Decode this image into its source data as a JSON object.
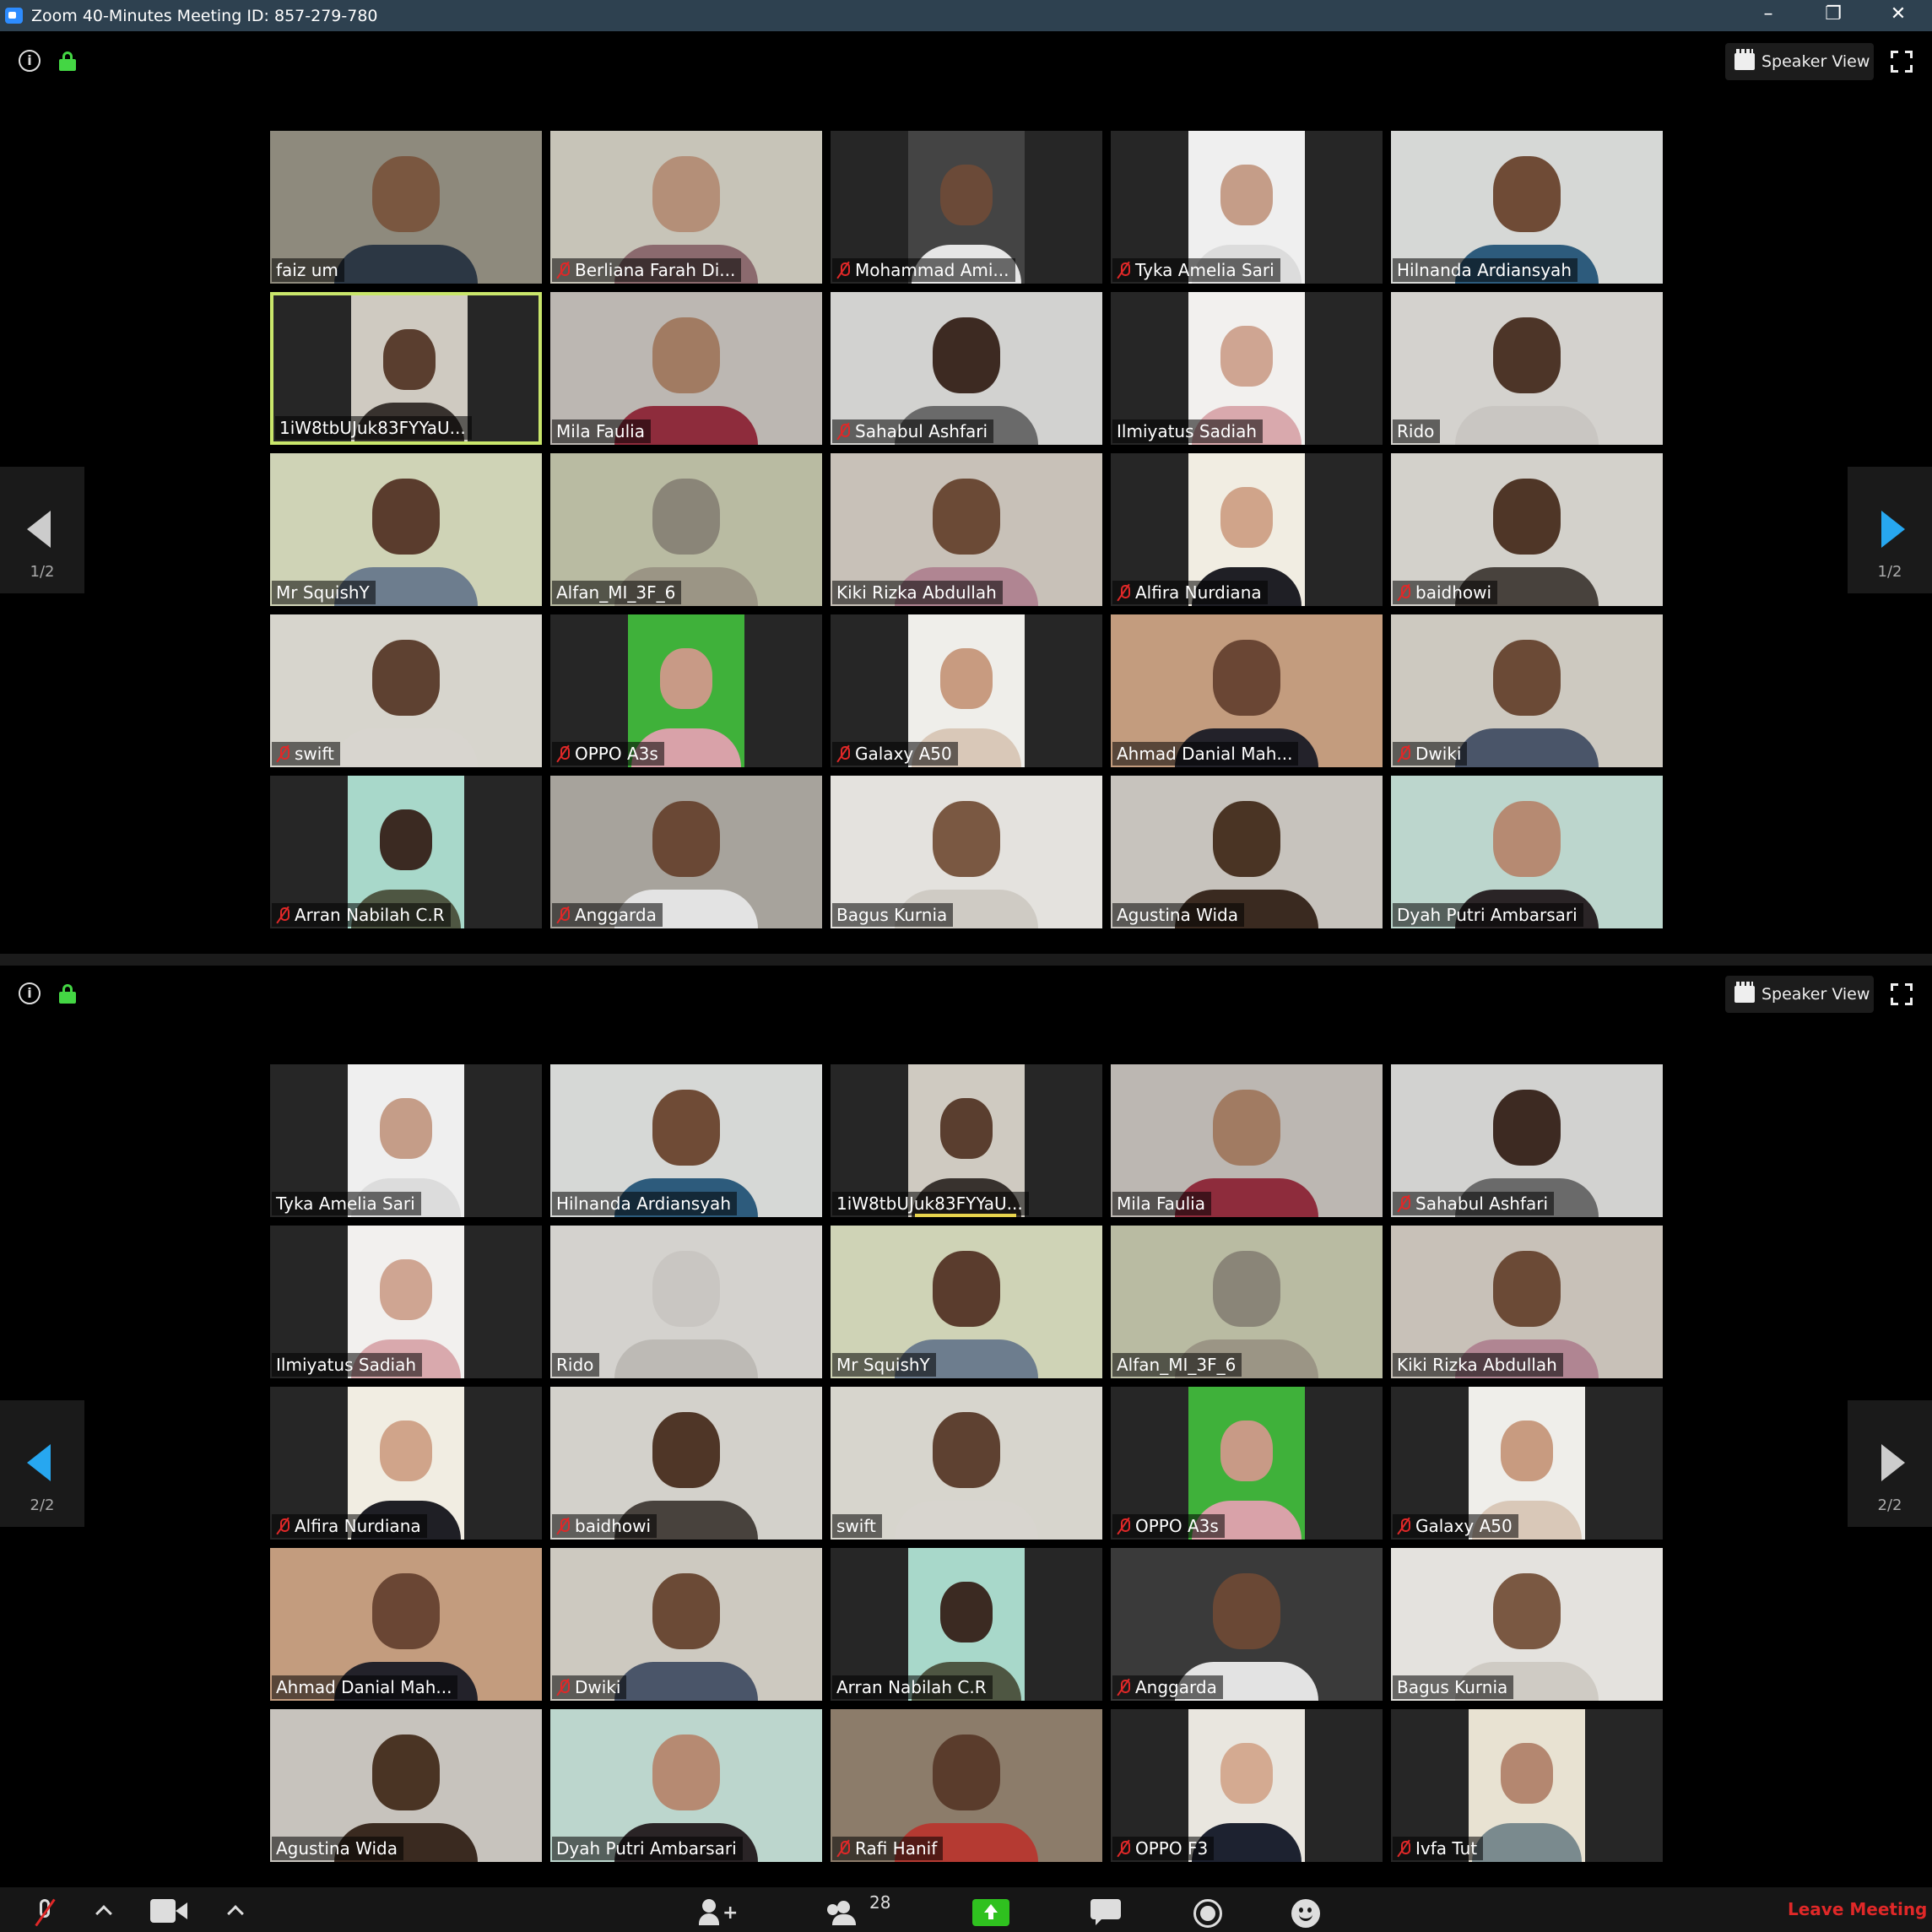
{
  "window": {
    "title": "Zoom 40-Minutes Meeting ID: 857-279-780",
    "minimize": "–",
    "restore": "❐",
    "close": "✕"
  },
  "header": {
    "speaker_view": "Speaker View"
  },
  "screens": [
    {
      "page_label": "1/2",
      "tiles": [
        {
          "name": "faiz um",
          "muted": false,
          "video": "full",
          "bg": "#8e8a7d",
          "skin": "#7a5740",
          "shirt": "#2c3744"
        },
        {
          "name": "Berliana Farah Di...",
          "muted": true,
          "video": "full",
          "bg": "#c7c4b8",
          "skin": "#b48f78",
          "shirt": "#8b6a6e"
        },
        {
          "name": "Mohammad Ami...",
          "muted": true,
          "video": "narrow",
          "bg": "#444",
          "skin": "#6b4a38",
          "shirt": "#e6e6e6"
        },
        {
          "name": "Tyka Amelia Sari",
          "muted": true,
          "video": "narrow",
          "bg": "#efefef",
          "skin": "#c59d88",
          "shirt": "#dcdcdc"
        },
        {
          "name": "Hilnanda Ardiansyah",
          "muted": false,
          "video": "full",
          "bg": "#d6d8d6",
          "skin": "#6f4b36",
          "shirt": "#2d5b7c"
        },
        {
          "name": "1iW8tbUJuk83FYYaU...",
          "muted": false,
          "video": "narrow",
          "bg": "#cfcac1",
          "skin": "#5a3e2f",
          "shirt": "#38322e",
          "active": true
        },
        {
          "name": "Mila Faulia",
          "muted": false,
          "video": "full",
          "bg": "#bcb7b2",
          "skin": "#a17b62",
          "shirt": "#8e2c3c"
        },
        {
          "name": "Sahabul Ashfari",
          "muted": true,
          "video": "full",
          "bg": "#d2d2d0",
          "skin": "#3d2a22",
          "shirt": "#6a6a6a"
        },
        {
          "name": "Ilmiyatus Sadiah",
          "muted": false,
          "video": "narrow",
          "bg": "#f2f0ee",
          "skin": "#cfa592",
          "shirt": "#d9a9ad"
        },
        {
          "name": "Rido",
          "muted": false,
          "video": "full",
          "bg": "#d4d2ce",
          "skin": "#4d3528",
          "shirt": "#c9c6c2"
        },
        {
          "name": "Mr SquishY",
          "muted": false,
          "video": "full",
          "bg": "#cfd3b6",
          "skin": "#5a3c2d",
          "shirt": "#6d7d8e"
        },
        {
          "name": "Alfan_MI_3F_6",
          "muted": false,
          "video": "full",
          "bg": "#b9bba2",
          "skin": "#8a8578",
          "shirt": "#9b9585"
        },
        {
          "name": "Kiki Rizka Abdullah",
          "muted": false,
          "video": "full",
          "bg": "#c8c1b8",
          "skin": "#6b4a36",
          "shirt": "#b08592"
        },
        {
          "name": "Alfira Nurdiana",
          "muted": true,
          "video": "narrow",
          "bg": "#f1ede2",
          "skin": "#d0a48a",
          "shirt": "#1f1f25"
        },
        {
          "name": "baidhowi",
          "muted": true,
          "video": "full",
          "bg": "#d3d1cb",
          "skin": "#4f3627",
          "shirt": "#48423d"
        },
        {
          "name": "swift",
          "muted": true,
          "video": "full",
          "bg": "#d7d5cd",
          "skin": "#5e4131",
          "shirt": "#d8d5cf"
        },
        {
          "name": "OPPO A3s",
          "muted": true,
          "video": "narrow",
          "bg": "#3fb13a",
          "skin": "#c89a86",
          "shirt": "#d9a2a9"
        },
        {
          "name": "Galaxy A50",
          "muted": true,
          "video": "narrow",
          "bg": "#efeeea",
          "skin": "#c89b80",
          "shirt": "#d9c8b8"
        },
        {
          "name": "Ahmad Danial Mah...",
          "muted": false,
          "video": "full",
          "bg": "#c39c7e",
          "skin": "#6a4634",
          "shirt": "#23222a"
        },
        {
          "name": "Dwiki",
          "muted": true,
          "video": "full",
          "bg": "#cdc9c0",
          "skin": "#6b4a36",
          "shirt": "#4a5569"
        },
        {
          "name": "Arran Nabilah C.R",
          "muted": true,
          "video": "narrow",
          "bg": "#a8d8ca",
          "skin": "#3b2a22",
          "shirt": "#4e5642"
        },
        {
          "name": "Anggarda",
          "muted": true,
          "video": "full",
          "bg": "#a7a39c",
          "skin": "#6a4835",
          "shirt": "#e3e3e3"
        },
        {
          "name": "Bagus Kurnia",
          "muted": false,
          "video": "full",
          "bg": "#e4e2de",
          "skin": "#7a5842",
          "shirt": "#cfcbc4"
        },
        {
          "name": "Agustina Wida",
          "muted": false,
          "video": "full",
          "bg": "#c7c3bd",
          "skin": "#4a3424",
          "shirt": "#3a2a20"
        },
        {
          "name": "Dyah Putri Ambarsari",
          "muted": false,
          "video": "full",
          "bg": "#bcd6cd",
          "skin": "#b68a72",
          "shirt": "#2a2426"
        }
      ]
    },
    {
      "page_label": "2/2",
      "tiles": [
        {
          "name": "Tyka Amelia Sari",
          "muted": false,
          "video": "narrow",
          "bg": "#efefef",
          "skin": "#c59d88",
          "shirt": "#dcdcdc"
        },
        {
          "name": "Hilnanda Ardiansyah",
          "muted": false,
          "video": "full",
          "bg": "#d6d8d6",
          "skin": "#6f4b36",
          "shirt": "#2d5b7c"
        },
        {
          "name": "1iW8tbUJuk83FYYaU...",
          "muted": false,
          "video": "narrow",
          "bg": "#cfcac1",
          "skin": "#5a3e2f",
          "shirt": "#38322e",
          "speaking": true
        },
        {
          "name": "Mila Faulia",
          "muted": false,
          "video": "full",
          "bg": "#bcb7b2",
          "skin": "#a17b62",
          "shirt": "#8e2c3c"
        },
        {
          "name": "Sahabul Ashfari",
          "muted": true,
          "video": "full",
          "bg": "#d2d2d0",
          "skin": "#3d2a22",
          "shirt": "#6a6a6a"
        },
        {
          "name": "Ilmiyatus Sadiah",
          "muted": false,
          "video": "narrow",
          "bg": "#f2f0ee",
          "skin": "#cfa592",
          "shirt": "#d9a9ad"
        },
        {
          "name": "Rido",
          "muted": false,
          "video": "full",
          "bg": "#d4d2ce",
          "skin": "#c9c6c2",
          "shirt": "#bdbab5"
        },
        {
          "name": "Mr SquishY",
          "muted": false,
          "video": "full",
          "bg": "#cfd3b6",
          "skin": "#5a3c2d",
          "shirt": "#6d7d8e"
        },
        {
          "name": "Alfan_MI_3F_6",
          "muted": false,
          "video": "full",
          "bg": "#b9bba2",
          "skin": "#8a8578",
          "shirt": "#9b9585"
        },
        {
          "name": "Kiki Rizka Abdullah",
          "muted": false,
          "video": "full",
          "bg": "#c8c1b8",
          "skin": "#6b4a36",
          "shirt": "#b08592"
        },
        {
          "name": "Alfira Nurdiana",
          "muted": true,
          "video": "narrow",
          "bg": "#f1ede2",
          "skin": "#d0a48a",
          "shirt": "#1f1f25"
        },
        {
          "name": "baidhowi",
          "muted": true,
          "video": "full",
          "bg": "#d3d1cb",
          "skin": "#4f3627",
          "shirt": "#48423d"
        },
        {
          "name": "swift",
          "muted": false,
          "video": "full",
          "bg": "#d7d5cd",
          "skin": "#5e4131",
          "shirt": "#d8d5cf"
        },
        {
          "name": "OPPO A3s",
          "muted": true,
          "video": "narrow",
          "bg": "#3fb13a",
          "skin": "#c89a86",
          "shirt": "#d9a2a9"
        },
        {
          "name": "Galaxy A50",
          "muted": true,
          "video": "narrow",
          "bg": "#efeeea",
          "skin": "#c89b80",
          "shirt": "#d9c8b8"
        },
        {
          "name": "Ahmad Danial Mah...",
          "muted": false,
          "video": "full",
          "bg": "#c39c7e",
          "skin": "#6a4634",
          "shirt": "#23222a"
        },
        {
          "name": "Dwiki",
          "muted": true,
          "video": "full",
          "bg": "#cdc9c0",
          "skin": "#6b4a36",
          "shirt": "#4a5569"
        },
        {
          "name": "Arran Nabilah C.R",
          "muted": false,
          "video": "narrow",
          "bg": "#a8d8ca",
          "skin": "#3b2a22",
          "shirt": "#4e5642"
        },
        {
          "name": "Anggarda",
          "muted": true,
          "video": "full",
          "bg": "#3a3a3a",
          "skin": "#6a4835",
          "shirt": "#e3e3e3"
        },
        {
          "name": "Bagus Kurnia",
          "muted": false,
          "video": "full",
          "bg": "#e4e2de",
          "skin": "#7a5842",
          "shirt": "#cfcbc4"
        },
        {
          "name": "Agustina Wida",
          "muted": false,
          "video": "full",
          "bg": "#c7c3bd",
          "skin": "#4a3424",
          "shirt": "#3a2a20"
        },
        {
          "name": "Dyah Putri Ambarsari",
          "muted": false,
          "video": "full",
          "bg": "#bcd6cd",
          "skin": "#b68a72",
          "shirt": "#2a2426"
        },
        {
          "name": "Rafi Hanif",
          "muted": true,
          "video": "full",
          "bg": "#8c7c6a",
          "skin": "#5a3c2c",
          "shirt": "#b53a32"
        },
        {
          "name": "OPPO F3",
          "muted": true,
          "video": "narrow",
          "bg": "#e9e6df",
          "skin": "#d4aa91",
          "shirt": "#1d2230"
        },
        {
          "name": "Ivfa Tut",
          "muted": true,
          "video": "narrow",
          "bg": "#e8e2d2",
          "skin": "#b48770",
          "shirt": "#7a8a8e"
        }
      ]
    }
  ],
  "toolbar": {
    "participants_count": "28",
    "leave": "Leave Meeting"
  }
}
